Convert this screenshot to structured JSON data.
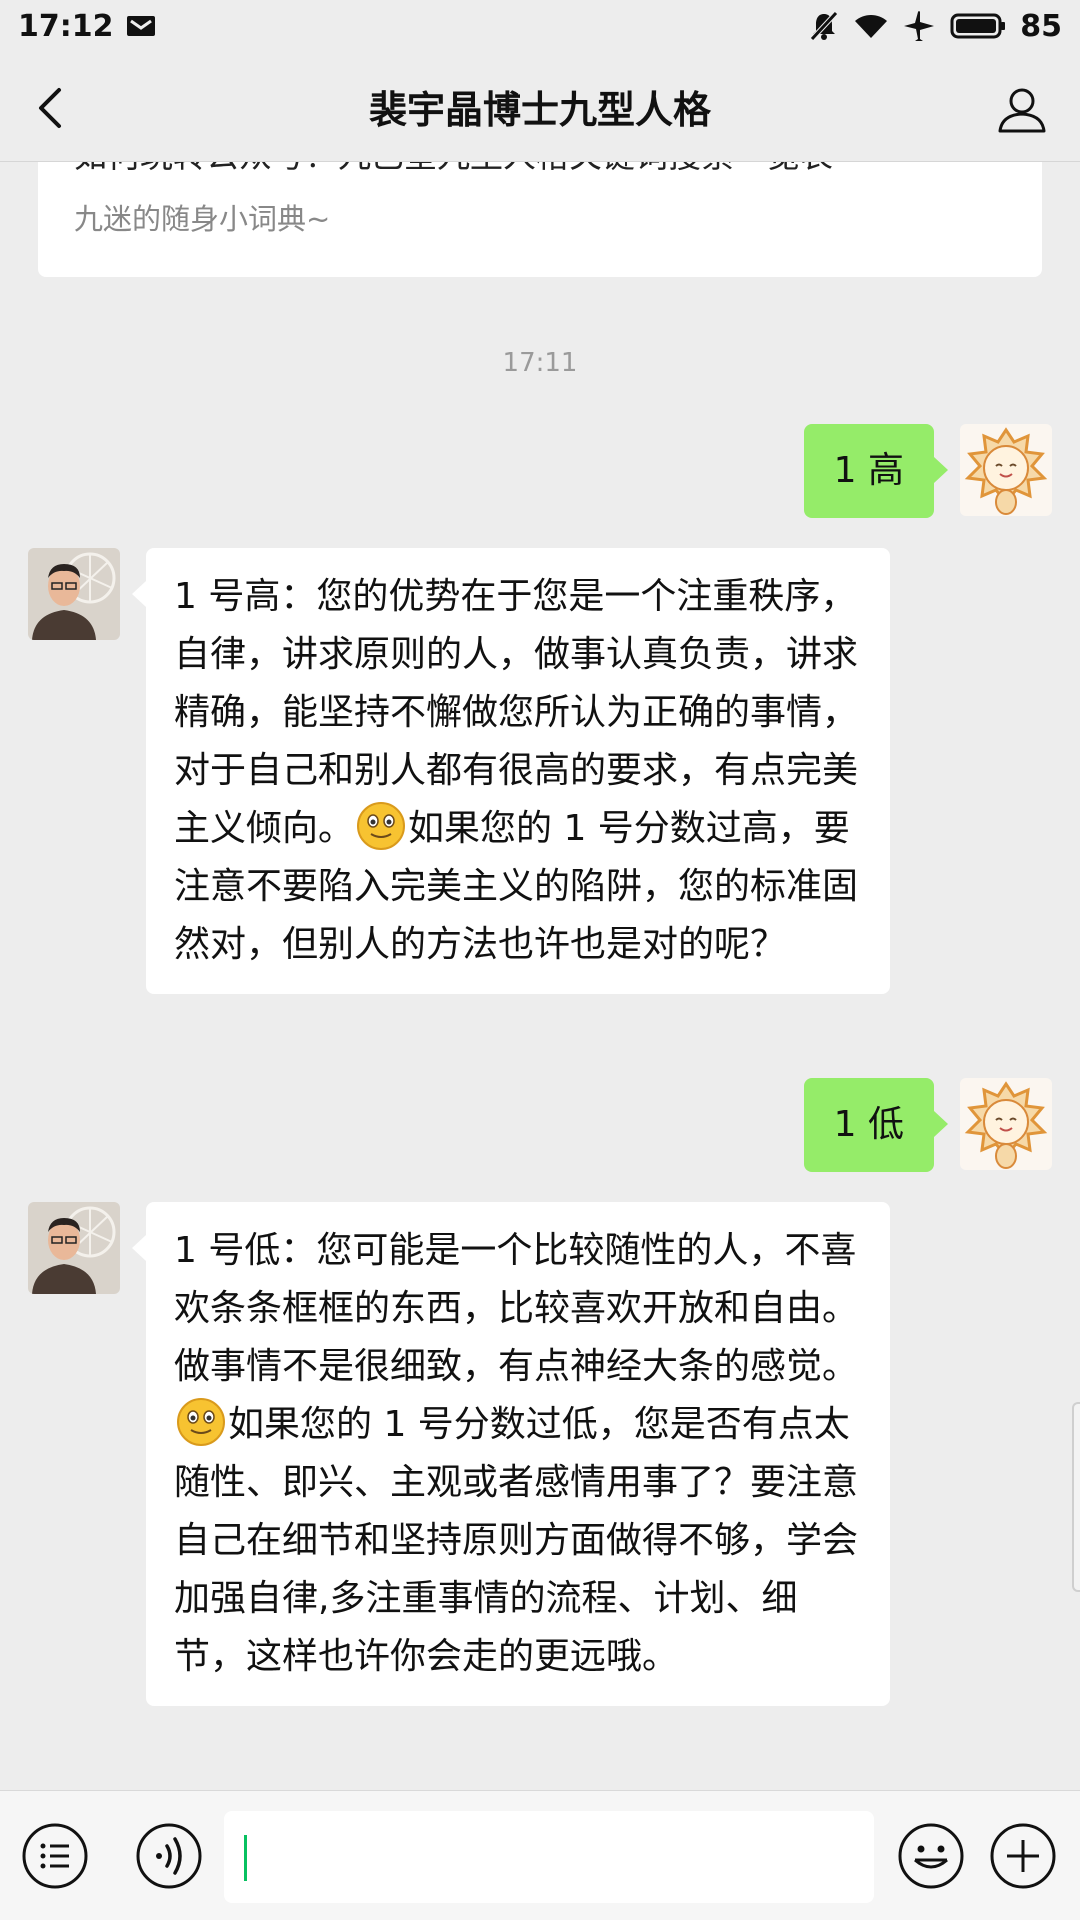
{
  "status_bar": {
    "time": "17:12",
    "battery": "85"
  },
  "nav": {
    "title": "裴宇晶博士九型人格"
  },
  "article": {
    "title": "如何玩转公众号？九巳星九型人格关键词搜索一览表",
    "subtitle": "九迷的随身小词典~"
  },
  "timestamp": "17:11",
  "messages": [
    {
      "side": "right",
      "text": "1 高"
    },
    {
      "side": "left",
      "text_before": "1 号高：您的优势在于您是一个注重秩序，自律，讲求原则的人，做事认真负责，讲求精确，能坚持不懈做您所认为正确的事情，对于自己和别人都有很高的要求，有点完美主义倾向。",
      "emoji": "smiling-emoji",
      "text_after": "如果您的 1 号分数过高，要注意不要陷入完美主义的陷阱，您的标准固然对，但别人的方法也许也是对的呢？"
    },
    {
      "side": "right",
      "text": "1 低"
    },
    {
      "side": "left",
      "text_before": "1 号低：您可能是一个比较随性的人，不喜欢条条框框的东西，比较喜欢开放和自由。做事情不是很细致，有点神经大条的感觉。",
      "emoji": "smiling-emoji",
      "text_after": "如果您的 1 号分数过低，您是否有点太随性、即兴、主观或者感情用事了？要注意自己在细节和坚持原则方面做得不够，学会加强自律,多注重事情的流程、计划、细节，这样也许你会走的更远哦。"
    }
  ],
  "input": {
    "value": "",
    "placeholder": ""
  },
  "colors": {
    "background": "#ededed",
    "bubble_sent": "#95ec69",
    "bubble_received": "#ffffff",
    "caret": "#07c160"
  }
}
